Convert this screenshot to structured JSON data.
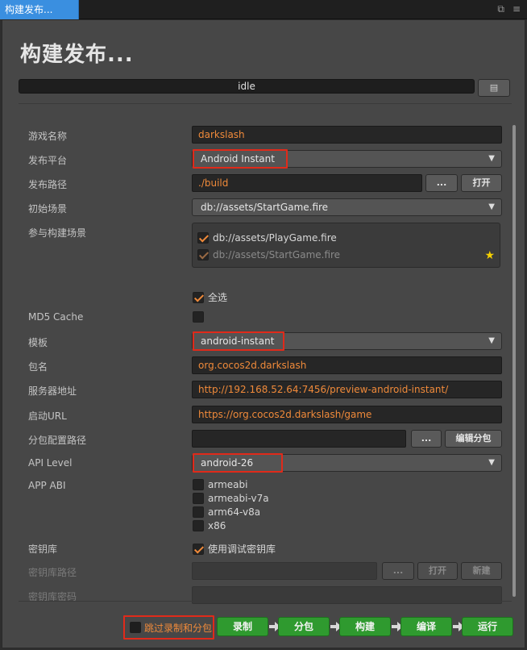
{
  "tab": {
    "title": "构建发布..."
  },
  "header": {
    "title": "构建发布..."
  },
  "progress": {
    "status": "idle"
  },
  "form": {
    "game_name": {
      "label": "游戏名称",
      "value": "darkslash"
    },
    "platform": {
      "label": "发布平台",
      "value": "Android Instant"
    },
    "build_path": {
      "label": "发布路径",
      "value": "./build",
      "browse_label": "...",
      "open_label": "打开"
    },
    "start_scene": {
      "label": "初始场景",
      "value": "db://assets/StartGame.fire"
    },
    "scenes": {
      "label": "参与构建场景",
      "items": [
        {
          "label": "db://assets/PlayGame.fire"
        },
        {
          "label": "db://assets/StartGame.fire"
        }
      ],
      "select_all_label": "全选"
    },
    "md5": {
      "label": "MD5 Cache"
    },
    "template": {
      "label": "模板",
      "value": "android-instant"
    },
    "package_name": {
      "label": "包名",
      "value": "org.cocos2d.darkslash"
    },
    "server_url": {
      "label": "服务器地址",
      "value": "http://192.168.52.64:7456/preview-android-instant/"
    },
    "launch_url": {
      "label": "启动URL",
      "value": "https://org.cocos2d.darkslash/game"
    },
    "subpackage_path": {
      "label": "分包配置路径",
      "value": "",
      "browse_label": "...",
      "edit_label": "编辑分包"
    },
    "api_level": {
      "label": "API Level",
      "value": "android-26"
    },
    "app_abi": {
      "label": "APP ABI",
      "options": [
        {
          "label": "armeabi"
        },
        {
          "label": "armeabi-v7a"
        },
        {
          "label": "arm64-v8a"
        },
        {
          "label": "x86"
        }
      ]
    },
    "keystore": {
      "label": "密钥库",
      "debug_label": "使用调试密钥库"
    },
    "keystore_path": {
      "label": "密钥库路径",
      "browse_label": "...",
      "open_label": "打开",
      "new_label": "新建"
    },
    "keystore_password": {
      "label": "密钥库密码"
    }
  },
  "actions": {
    "skip_label": "跳过录制和分包",
    "record": "录制",
    "subpackage": "分包",
    "build": "构建",
    "compile": "编译",
    "run": "运行"
  },
  "colors": {
    "accent": "#f08a3a",
    "highlight": "#e02a1a",
    "action": "#2f9a2f",
    "tab": "#3a8fe0"
  }
}
